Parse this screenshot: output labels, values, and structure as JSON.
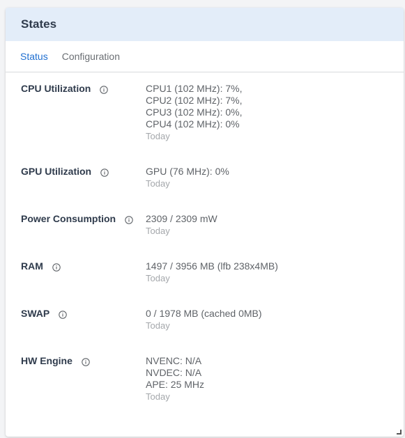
{
  "panel": {
    "title": "States"
  },
  "tabs": [
    {
      "label": "Status",
      "active": true
    },
    {
      "label": "Configuration",
      "active": false
    }
  ],
  "colors": {
    "header_bg": "#e3edf9",
    "active_tab": "#1f6fd1",
    "label_text": "#2f3b4c",
    "value_text": "#5f6368",
    "time_text": "#a4a7ab"
  },
  "states": [
    {
      "label": "CPU Utilization",
      "icon": "info-icon",
      "values": [
        "CPU1 (102 MHz): 7%,",
        "CPU2 (102 MHz): 7%,",
        "CPU3 (102 MHz): 0%,",
        "CPU4 (102 MHz): 0%"
      ],
      "time": "Today"
    },
    {
      "label": "GPU Utilization",
      "icon": "info-icon",
      "values": [
        "GPU (76 MHz): 0%"
      ],
      "time": "Today"
    },
    {
      "label": "Power Consumption",
      "icon": "info-icon",
      "values": [
        "2309 / 2309 mW"
      ],
      "time": "Today"
    },
    {
      "label": "RAM",
      "icon": "info-icon",
      "values": [
        "1497 / 3956 MB (lfb 238x4MB)"
      ],
      "time": "Today"
    },
    {
      "label": "SWAP",
      "icon": "info-icon",
      "values": [
        "0 / 1978 MB (cached 0MB)"
      ],
      "time": "Today"
    },
    {
      "label": "HW Engine",
      "icon": "info-icon",
      "values": [
        "NVENC: N/A",
        "NVDEC: N/A",
        "APE: 25 MHz"
      ],
      "time": "Today"
    }
  ]
}
